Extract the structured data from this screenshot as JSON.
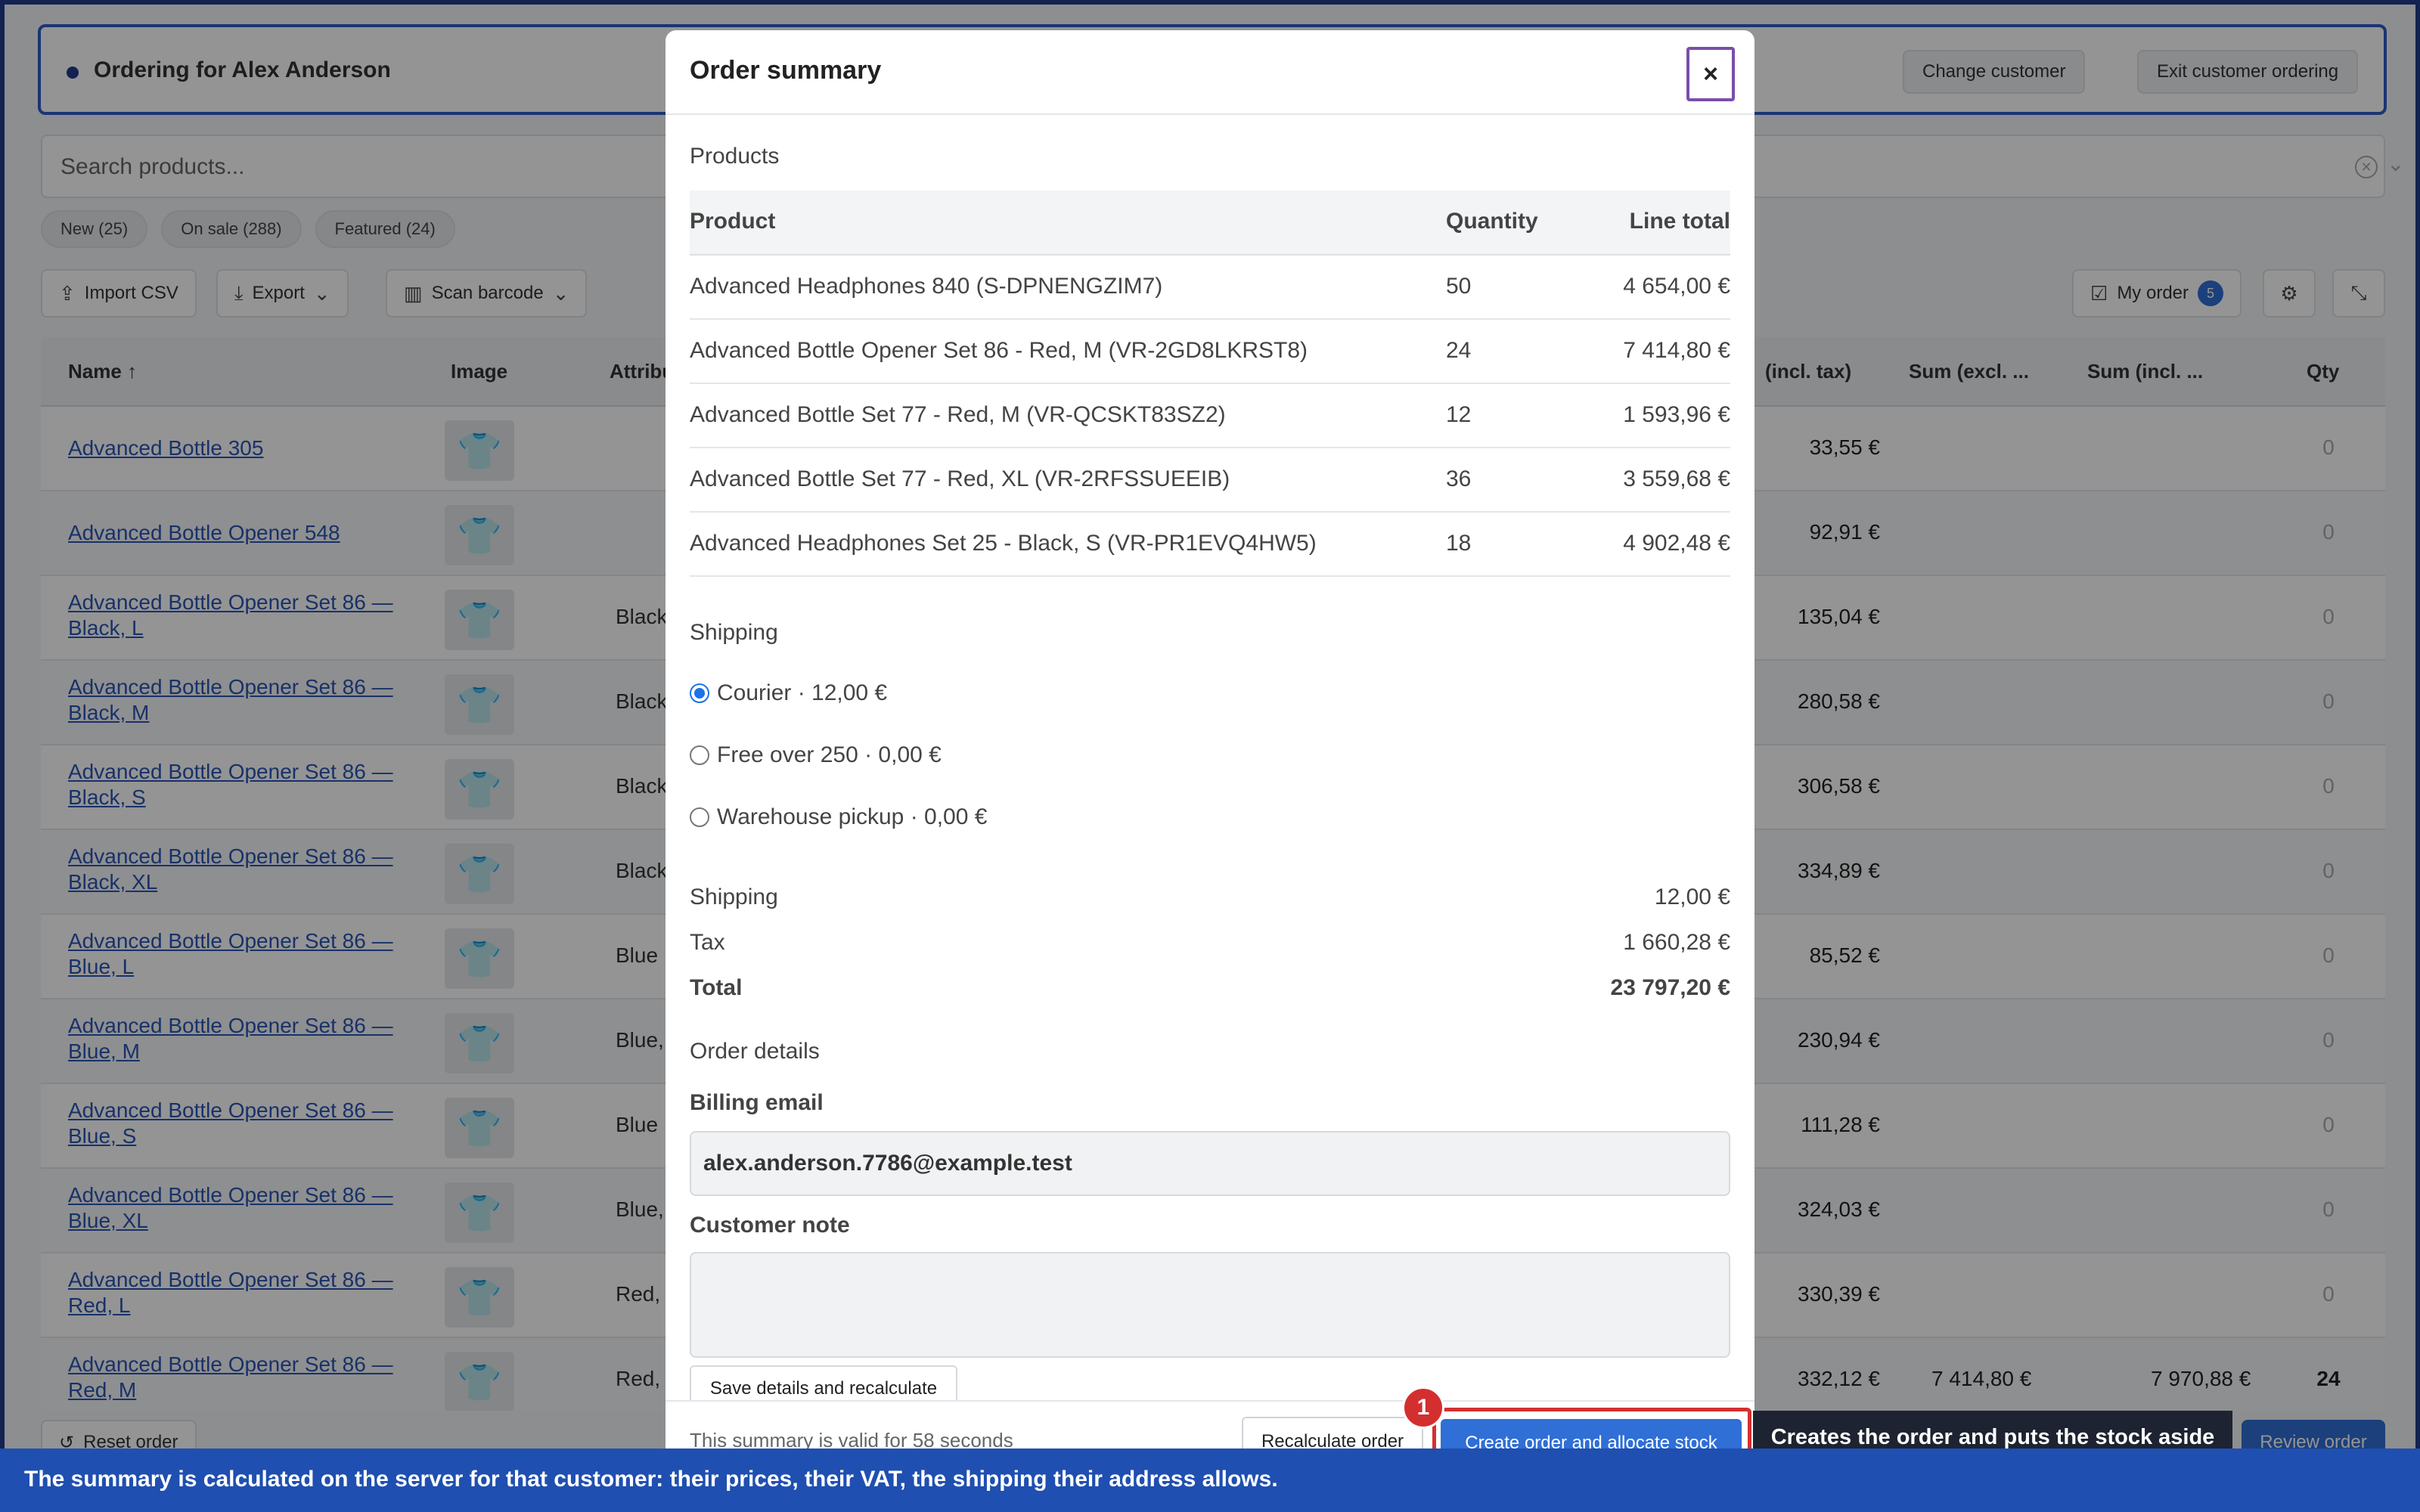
{
  "banner": {
    "title": "Ordering for Alex Anderson",
    "help_label": "?",
    "change_customer": "Change customer",
    "exit_ordering": "Exit customer ordering"
  },
  "search": {
    "placeholder": "Search products..."
  },
  "chips": [
    {
      "label": "New (25)"
    },
    {
      "label": "On sale (288)"
    },
    {
      "label": "Featured (24)"
    }
  ],
  "toolbar": {
    "import_csv": "Import CSV",
    "export": "Export",
    "scan_barcode": "Scan barcode",
    "my_order": "My order",
    "my_order_count": "5"
  },
  "grid": {
    "columns": {
      "name": "Name",
      "image": "Image",
      "attributes": "Attribu",
      "price_incl": "(incl. tax)",
      "sum_excl": "Sum (excl. ...",
      "sum_incl": "Sum (incl. ...",
      "qty": "Qty"
    },
    "rows": [
      {
        "name": "Advanced Bottle 305",
        "attr": "",
        "price": "33,55 €",
        "sum_excl": "",
        "sum_incl": "",
        "qty": "0"
      },
      {
        "name": "Advanced Bottle Opener 548",
        "attr": "",
        "price": "92,91 €",
        "sum_excl": "",
        "sum_incl": "",
        "qty": "0"
      },
      {
        "name": "Advanced Bottle Opener Set 86 — Black, L",
        "attr": "Black",
        "price": "135,04 €",
        "sum_excl": "",
        "sum_incl": "",
        "qty": "0"
      },
      {
        "name": "Advanced Bottle Opener Set 86 — Black, M",
        "attr": "Black",
        "price": "280,58 €",
        "sum_excl": "",
        "sum_incl": "",
        "qty": "0"
      },
      {
        "name": "Advanced Bottle Opener Set 86 — Black, S",
        "attr": "Black",
        "price": "306,58 €",
        "sum_excl": "",
        "sum_incl": "",
        "qty": "0"
      },
      {
        "name": "Advanced Bottle Opener Set 86 — Black, XL",
        "attr": "Black,",
        "price": "334,89 €",
        "sum_excl": "",
        "sum_incl": "",
        "qty": "0"
      },
      {
        "name": "Advanced Bottle Opener Set 86 — Blue, L",
        "attr": "Blue",
        "price": "85,52 €",
        "sum_excl": "",
        "sum_incl": "",
        "qty": "0"
      },
      {
        "name": "Advanced Bottle Opener Set 86 — Blue, M",
        "attr": "Blue,",
        "price": "230,94 €",
        "sum_excl": "",
        "sum_incl": "",
        "qty": "0"
      },
      {
        "name": "Advanced Bottle Opener Set 86 — Blue, S",
        "attr": "Blue",
        "price": "111,28 €",
        "sum_excl": "",
        "sum_incl": "",
        "qty": "0"
      },
      {
        "name": "Advanced Bottle Opener Set 86 — Blue, XL",
        "attr": "Blue,",
        "price": "324,03 €",
        "sum_excl": "",
        "sum_incl": "",
        "qty": "0"
      },
      {
        "name": "Advanced Bottle Opener Set 86 — Red, L",
        "attr": "Red,",
        "price": "330,39 €",
        "sum_excl": "",
        "sum_incl": "",
        "qty": "0"
      },
      {
        "name": "Advanced Bottle Opener Set 86 — Red, M",
        "attr": "Red,",
        "price": "332,12 €",
        "sum_excl": "7 414,80 €",
        "sum_incl": "7 970,88 €",
        "qty": "24"
      }
    ]
  },
  "bottom": {
    "reset_order": "Reset order",
    "review_order": "Review order"
  },
  "modal": {
    "title": "Order summary",
    "close_label": "×",
    "products_title": "Products",
    "table_headers": {
      "product": "Product",
      "quantity": "Quantity",
      "line_total": "Line total"
    },
    "products": [
      {
        "product": "Advanced Headphones 840 (S-DPNENGZIM7)",
        "quantity": "50",
        "line_total": "4 654,00 €"
      },
      {
        "product": "Advanced Bottle Opener Set 86 - Red, M (VR-2GD8LKRST8)",
        "quantity": "24",
        "line_total": "7 414,80 €"
      },
      {
        "product": "Advanced Bottle Set 77 - Red, M (VR-QCSKT83SZ2)",
        "quantity": "12",
        "line_total": "1 593,96 €"
      },
      {
        "product": "Advanced Bottle Set 77 - Red, XL (VR-2RFSSUEEIB)",
        "quantity": "36",
        "line_total": "3 559,68 €"
      },
      {
        "product": "Advanced Headphones Set 25 - Black, S (VR-PR1EVQ4HW5)",
        "quantity": "18",
        "line_total": "4 902,48 €"
      }
    ],
    "shipping_title": "Shipping",
    "shipping_options": [
      {
        "label": "Courier · 12,00 €",
        "checked": true
      },
      {
        "label": "Free over 250 · 0,00 €",
        "checked": false
      },
      {
        "label": "Warehouse pickup · 0,00 €",
        "checked": false
      }
    ],
    "summary": {
      "shipping_label": "Shipping",
      "shipping_value": "12,00 €",
      "tax_label": "Tax",
      "tax_value": "1 660,28 €",
      "total_label": "Total",
      "total_value": "23 797,20 €"
    },
    "order_details_title": "Order details",
    "billing_email_label": "Billing email",
    "billing_email_value": "alex.anderson.7786@example.test",
    "customer_note_label": "Customer note",
    "customer_note_value": "",
    "save_details": "Save details and recalculate",
    "valid_text": "This summary is valid for 58 seconds",
    "recalculate": "Recalculate order",
    "create_order": "Create order and allocate stock"
  },
  "annotation": {
    "step_number": "1",
    "tooltip": "Creates the order and puts the stock aside",
    "caption": "The summary is calculated on the server for that customer: their prices, their VAT, the shipping their address allows."
  }
}
